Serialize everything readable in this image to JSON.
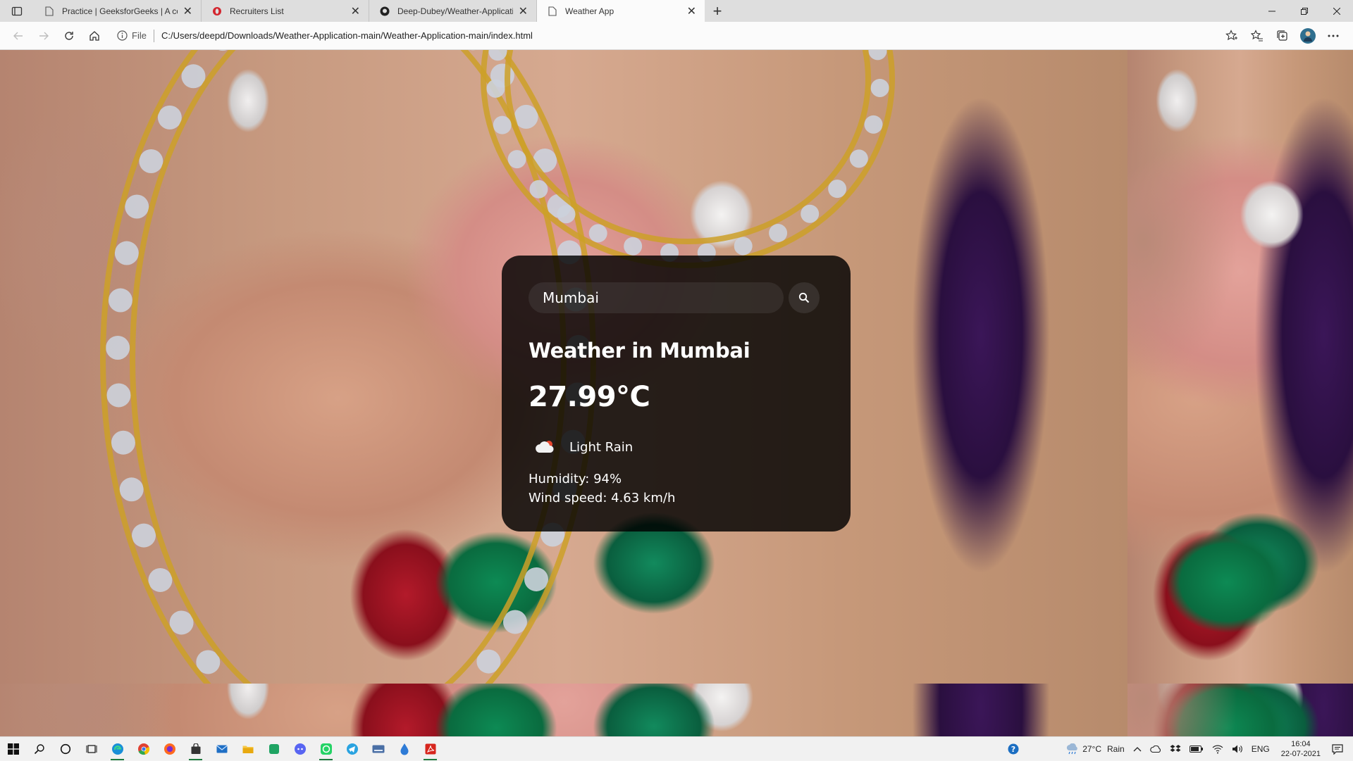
{
  "browser": {
    "tabs": [
      {
        "title": "Practice | GeeksforGeeks | A com",
        "active": false
      },
      {
        "title": "Recruiters List",
        "active": false
      },
      {
        "title": "Deep-Dubey/Weather-Applicatio",
        "active": false
      },
      {
        "title": "Weather App",
        "active": true
      }
    ],
    "address": {
      "info_label": "File",
      "url": "C:/Users/deepd/Downloads/Weather-Application-main/Weather-Application-main/index.html"
    }
  },
  "weather": {
    "search_value": "Mumbai",
    "city_heading": "Weather in Mumbai",
    "temperature": "27.99°C",
    "icon": "cloud-rain-icon",
    "description": "Light Rain",
    "humidity": "Humidity: 94%",
    "wind": "Wind speed: 4.63 km/h"
  },
  "taskbar": {
    "weather": {
      "temp": "27°C",
      "condition": "Rain"
    },
    "language": "ENG",
    "time": "16:04",
    "date": "22-07-2021"
  },
  "colors": {
    "card_background": "#000000",
    "tab_strip": "#dedede",
    "toolbar": "#fbfbfb"
  }
}
